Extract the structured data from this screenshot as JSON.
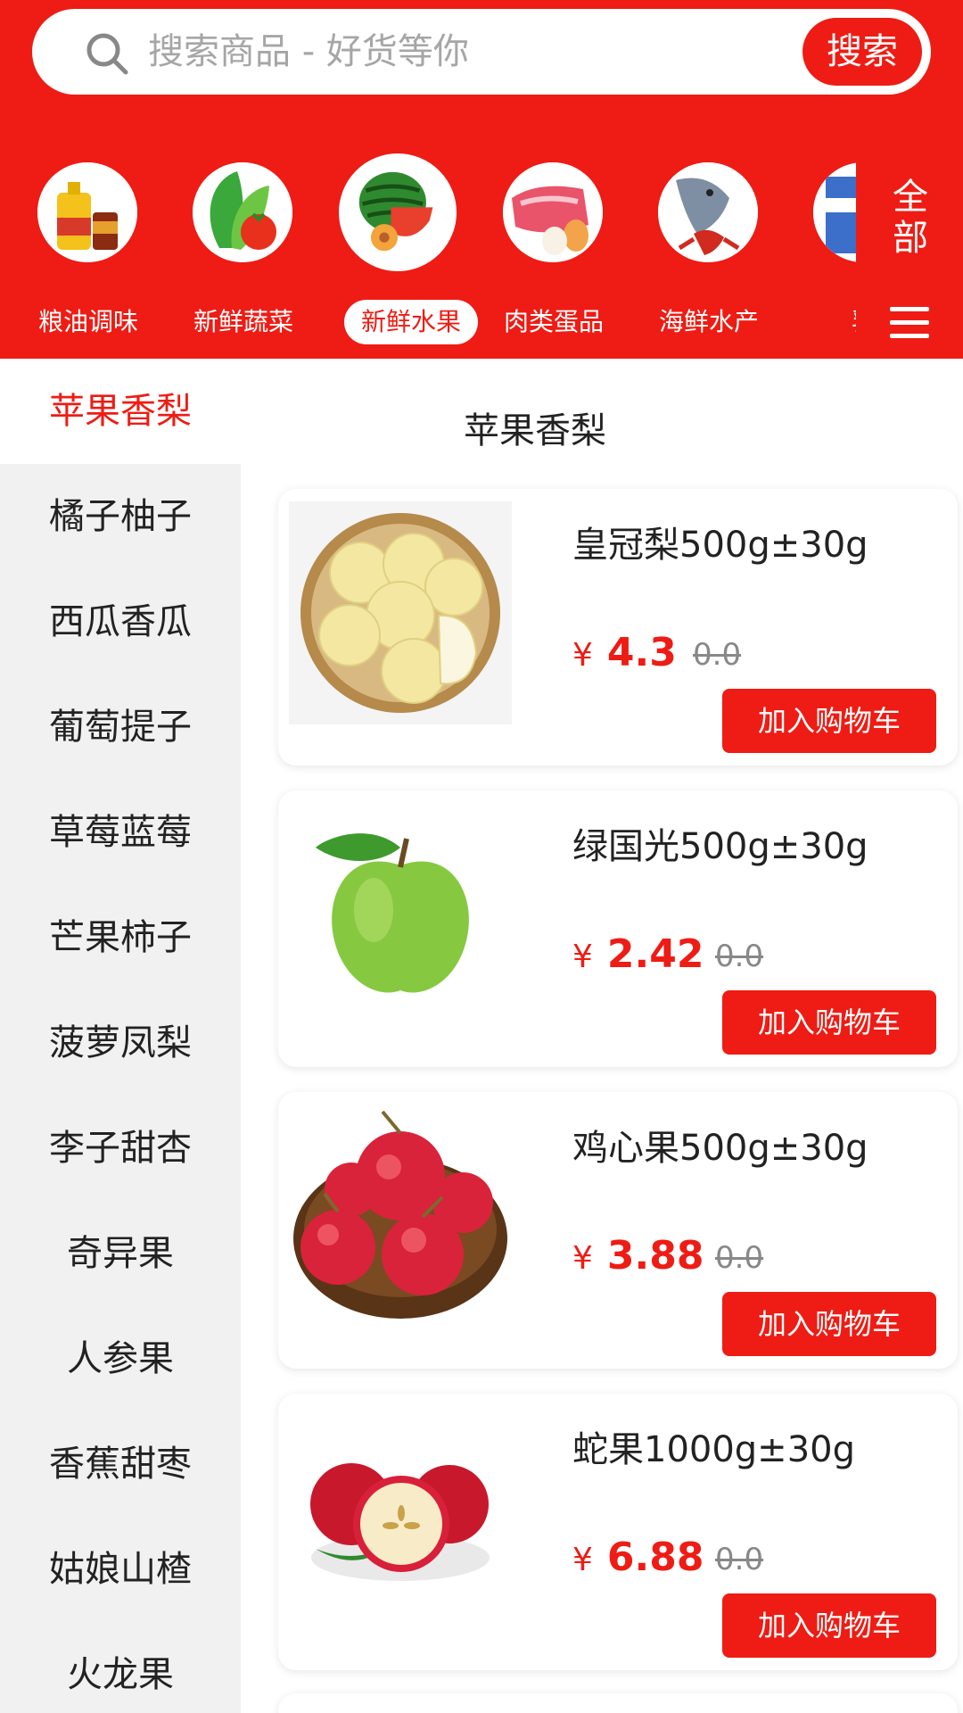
{
  "search": {
    "placeholder": "搜索商品 - 好货等你",
    "button_label": "搜索"
  },
  "categories": [
    {
      "label": "粮油调味",
      "icon": "oil-product-icon",
      "active": false
    },
    {
      "label": "新鲜蔬菜",
      "icon": "vegetable-icon",
      "active": false
    },
    {
      "label": "新鲜水果",
      "icon": "watermelon-icon",
      "active": true
    },
    {
      "label": "肉类蛋品",
      "icon": "meat-egg-icon",
      "active": false
    },
    {
      "label": "海鲜水产",
      "icon": "seafood-icon",
      "active": false
    },
    {
      "label": "乳",
      "icon": "dairy-icon",
      "active": false
    }
  ],
  "all_categories_label": "全部",
  "sidebar": {
    "items": [
      {
        "label": "苹果香梨",
        "active": true
      },
      {
        "label": "橘子柚子"
      },
      {
        "label": "西瓜香瓜"
      },
      {
        "label": "葡萄提子"
      },
      {
        "label": "草莓蓝莓"
      },
      {
        "label": "芒果柿子"
      },
      {
        "label": "菠萝凤梨"
      },
      {
        "label": "李子甜杏"
      },
      {
        "label": "奇异果"
      },
      {
        "label": "人参果"
      },
      {
        "label": "香蕉甜枣"
      },
      {
        "label": "姑娘山楂"
      },
      {
        "label": "火龙果"
      }
    ]
  },
  "section_title": "苹果香梨",
  "products": [
    {
      "name": "皇冠梨500g±30g",
      "currency": "¥",
      "price": "4.3",
      "original_price": "0.0",
      "cart_label": "加入购物车",
      "image": "pear-basket-image"
    },
    {
      "name": "绿国光500g±30g",
      "currency": "¥",
      "price": "2.42",
      "original_price": "0.0",
      "cart_label": "加入购物车",
      "image": "green-apple-image"
    },
    {
      "name": "鸡心果500g±30g",
      "currency": "¥",
      "price": "3.88",
      "original_price": "0.0",
      "cart_label": "加入购物车",
      "image": "red-apples-bowl-image"
    },
    {
      "name": "蛇果1000g±30g",
      "currency": "¥",
      "price": "6.88",
      "original_price": "0.0",
      "cart_label": "加入购物车",
      "image": "red-delicious-apple-image"
    }
  ],
  "colors": {
    "brand_red": "#ee1c14",
    "sidebar_bg": "#f1f1f1",
    "old_price_gray": "#888888"
  }
}
